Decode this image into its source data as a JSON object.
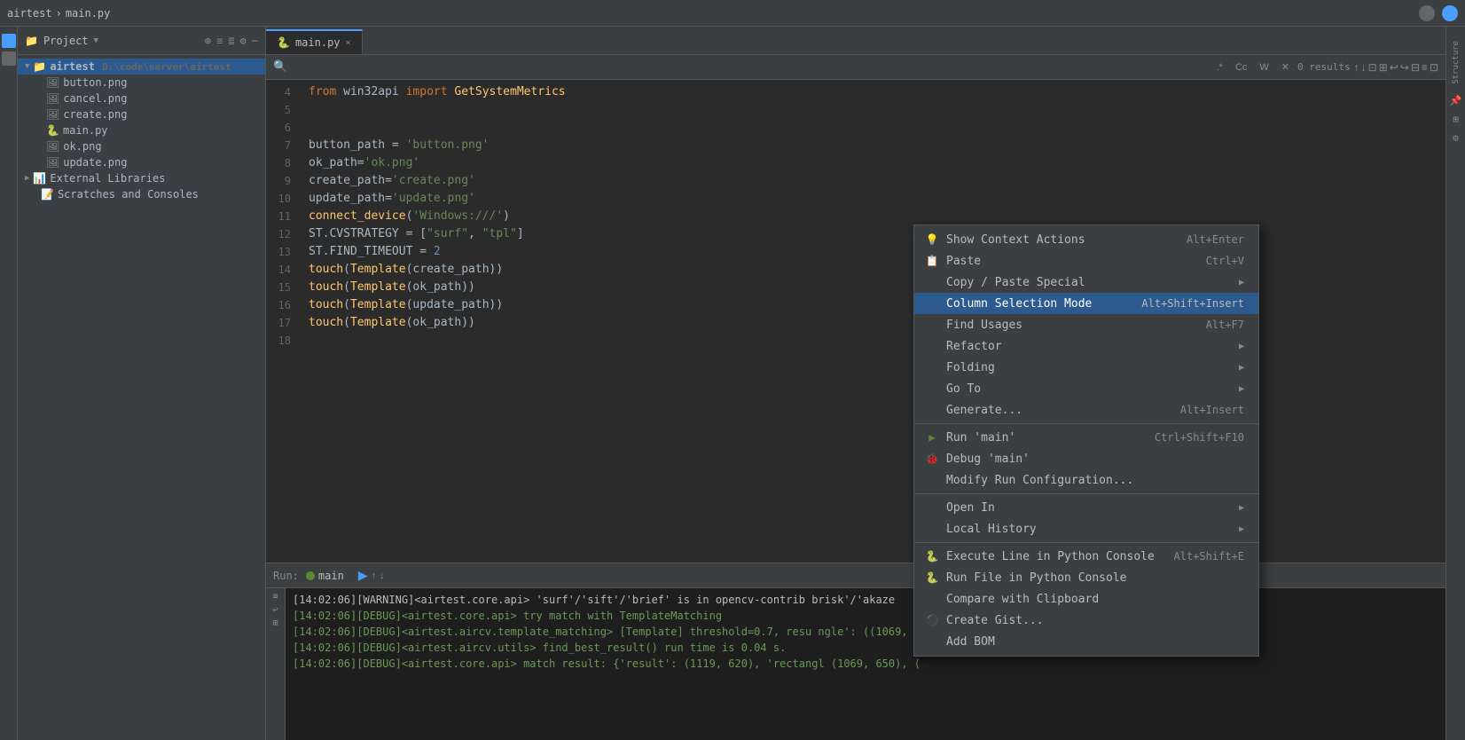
{
  "topbar": {
    "breadcrumb": [
      "airtest",
      "main.py"
    ],
    "separator": "›"
  },
  "project": {
    "header": "Project",
    "root": "airtest",
    "root_path": "D:\\code\\server\\airtest",
    "files": [
      {
        "name": "button.png",
        "type": "png"
      },
      {
        "name": "cancel.png",
        "type": "png"
      },
      {
        "name": "create.png",
        "type": "png"
      },
      {
        "name": "main.py",
        "type": "py"
      },
      {
        "name": "ok.png",
        "type": "png"
      },
      {
        "name": "update.png",
        "type": "png"
      }
    ],
    "external_libs": "External Libraries",
    "scratches": "Scratches and Consoles"
  },
  "tab": {
    "label": "main.py",
    "close": "×"
  },
  "search": {
    "placeholder": "",
    "results": "0 results"
  },
  "code": {
    "lines": [
      {
        "num": "4",
        "text": "from win32api import GetSystemMetrics"
      },
      {
        "num": "5",
        "text": ""
      },
      {
        "num": "6",
        "text": ""
      },
      {
        "num": "7",
        "text": "button_path = 'button.png'"
      },
      {
        "num": "8",
        "text": "ok_path='ok.png'"
      },
      {
        "num": "9",
        "text": "create_path='create.png'"
      },
      {
        "num": "10",
        "text": "update_path='update.png'"
      },
      {
        "num": "11",
        "text": "connect_device('Windows:///')"
      },
      {
        "num": "12",
        "text": "ST.CVSTRATEGY = [\"surf\", \"tpl\"]"
      },
      {
        "num": "13",
        "text": "ST.FIND_TIMEOUT = 2"
      },
      {
        "num": "14",
        "text": "touch(Template(create_path))"
      },
      {
        "num": "15",
        "text": "touch(Template(ok_path))"
      },
      {
        "num": "16",
        "text": "touch(Template(update_path))"
      },
      {
        "num": "17",
        "text": "touch(Template(ok_path))"
      },
      {
        "num": "18",
        "text": ""
      }
    ]
  },
  "run_panel": {
    "tab_label": "main",
    "output_lines": [
      {
        "text": "[14:02:06][WARNING]<airtest.core.api> 'surf'/'sift'/'brief' is in opencv-contrib   brisk'/'akaze",
        "cls": "warn"
      },
      {
        "text": "[14:02:06][DEBUG]<airtest.core.api> try match with TemplateMatching",
        "cls": "debug"
      },
      {
        "text": "[14:02:06][DEBUG]<airtest.aircv.template_matching> [Template] threshold=0.7, resu   ngle': ((1069,",
        "cls": "debug"
      },
      {
        "text": "[14:02:06][DEBUG]<airtest.aircv.utils> find_best_result() run time is 0.04 s.",
        "cls": "debug"
      },
      {
        "text": "[14:02:06][DEBUG]<airtest.core.api> match result: {'result': (1119, 620), 'rectangl   (1069, 650), (",
        "cls": "debug"
      }
    ]
  },
  "context_menu": {
    "items": [
      {
        "label": "Show Context Actions",
        "shortcut": "Alt+Enter",
        "icon": "bulb",
        "has_arrow": false,
        "highlighted": false,
        "separator_after": false
      },
      {
        "label": "Paste",
        "shortcut": "Ctrl+V",
        "icon": "paste",
        "has_arrow": false,
        "highlighted": false,
        "separator_after": false
      },
      {
        "label": "Copy / Paste Special",
        "shortcut": "",
        "icon": "",
        "has_arrow": true,
        "highlighted": false,
        "separator_after": false
      },
      {
        "label": "Column Selection Mode",
        "shortcut": "Alt+Shift+Insert",
        "icon": "",
        "has_arrow": false,
        "highlighted": true,
        "separator_after": false
      },
      {
        "label": "Find Usages",
        "shortcut": "Alt+F7",
        "icon": "",
        "has_arrow": false,
        "highlighted": false,
        "separator_after": false
      },
      {
        "label": "Refactor",
        "shortcut": "",
        "icon": "",
        "has_arrow": true,
        "highlighted": false,
        "separator_after": false
      },
      {
        "label": "Folding",
        "shortcut": "",
        "icon": "",
        "has_arrow": true,
        "highlighted": false,
        "separator_after": false
      },
      {
        "label": "Go To",
        "shortcut": "",
        "icon": "",
        "has_arrow": true,
        "highlighted": false,
        "separator_after": false
      },
      {
        "label": "Generate...",
        "shortcut": "Alt+Insert",
        "icon": "",
        "has_arrow": false,
        "highlighted": false,
        "separator_after": true
      },
      {
        "label": "Run 'main'",
        "shortcut": "Ctrl+Shift+F10",
        "icon": "run",
        "has_arrow": false,
        "highlighted": false,
        "separator_after": false
      },
      {
        "label": "Debug 'main'",
        "shortcut": "",
        "icon": "debug",
        "has_arrow": false,
        "highlighted": false,
        "separator_after": false
      },
      {
        "label": "Modify Run Configuration...",
        "shortcut": "",
        "icon": "",
        "has_arrow": false,
        "highlighted": false,
        "separator_after": true
      },
      {
        "label": "Open In",
        "shortcut": "",
        "icon": "",
        "has_arrow": true,
        "highlighted": false,
        "separator_after": false
      },
      {
        "label": "Local History",
        "shortcut": "",
        "icon": "",
        "has_arrow": true,
        "highlighted": false,
        "separator_after": true
      },
      {
        "label": "Execute Line in Python Console",
        "shortcut": "Alt+Shift+E",
        "icon": "python",
        "has_arrow": false,
        "highlighted": false,
        "separator_after": false
      },
      {
        "label": "Run File in Python Console",
        "shortcut": "",
        "icon": "python",
        "has_arrow": false,
        "highlighted": false,
        "separator_after": false
      },
      {
        "label": "Compare with Clipboard",
        "shortcut": "",
        "icon": "",
        "has_arrow": false,
        "highlighted": false,
        "separator_after": false
      },
      {
        "label": "Create Gist...",
        "shortcut": "",
        "icon": "github",
        "has_arrow": false,
        "highlighted": false,
        "separator_after": false
      },
      {
        "label": "Add BOM",
        "shortcut": "",
        "icon": "",
        "has_arrow": false,
        "highlighted": false,
        "separator_after": false
      }
    ]
  }
}
